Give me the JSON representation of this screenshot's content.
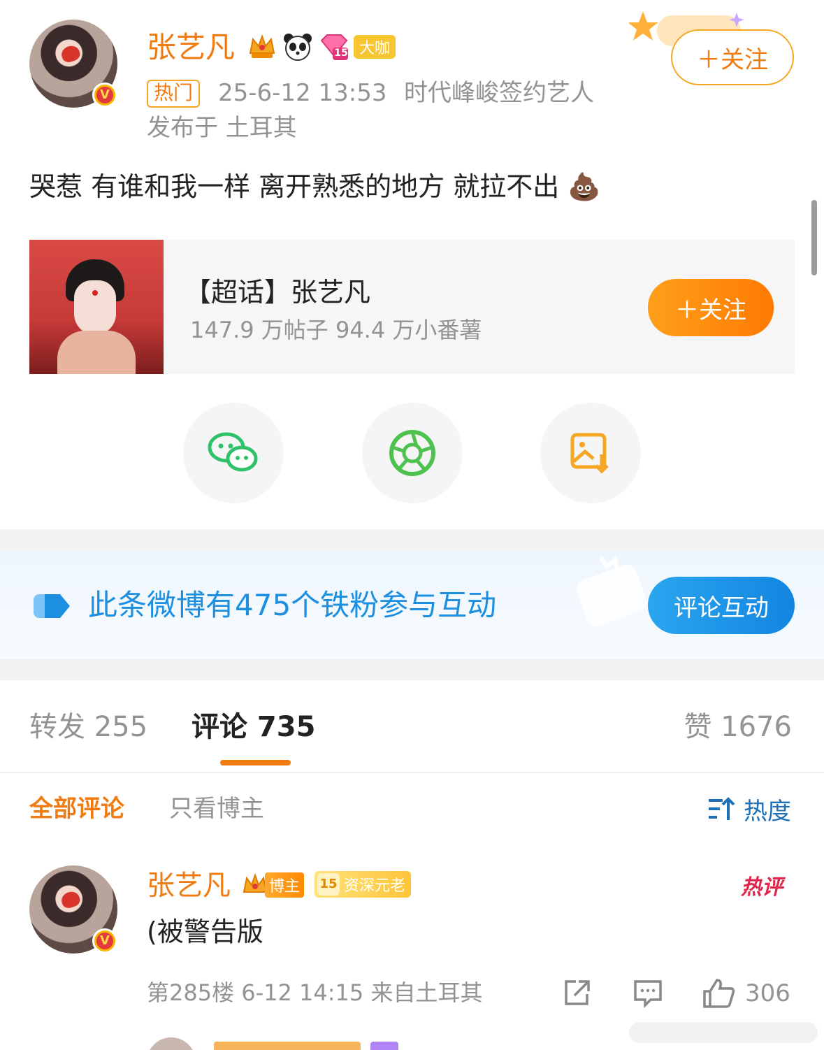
{
  "post": {
    "author": "张艺凡",
    "badge_vip": "大咖",
    "hot_tag": "热门",
    "time": "25-6-12 13:53",
    "affiliation": "时代峰峻签约艺人",
    "location": "发布于 土耳其",
    "follow_label": "＋关注",
    "content": "哭惹 有谁和我一样 离开熟悉的地方 就拉不出 💩",
    "level_badge": "15"
  },
  "supertopic": {
    "title": "【超话】张艺凡",
    "stats": "147.9 万帖子 94.4 万小番薯",
    "follow_label": "＋关注"
  },
  "share": {
    "items": [
      "wechat-icon",
      "moments-icon",
      "save-image-icon"
    ]
  },
  "fans_banner": {
    "text": "此条微博有475个铁粉参与互动",
    "button": "评论互动"
  },
  "tabs": {
    "repost": "转发 255",
    "comments": "评论 735",
    "likes": "赞 1676"
  },
  "filter": {
    "all": "全部评论",
    "author_only": "只看博主",
    "sort": "热度"
  },
  "comment": {
    "author": "张艺凡",
    "role_badge": "博主",
    "senior_badge": "资深元老",
    "senior_level": "15",
    "hot_label": "热评",
    "text": "(被警告版",
    "meta": "第285楼 6-12 14:15 来自土耳其",
    "likes": "306"
  },
  "colors": {
    "accent": "#f07b10",
    "blue": "#1d8fe0",
    "gray_text": "#939393"
  }
}
